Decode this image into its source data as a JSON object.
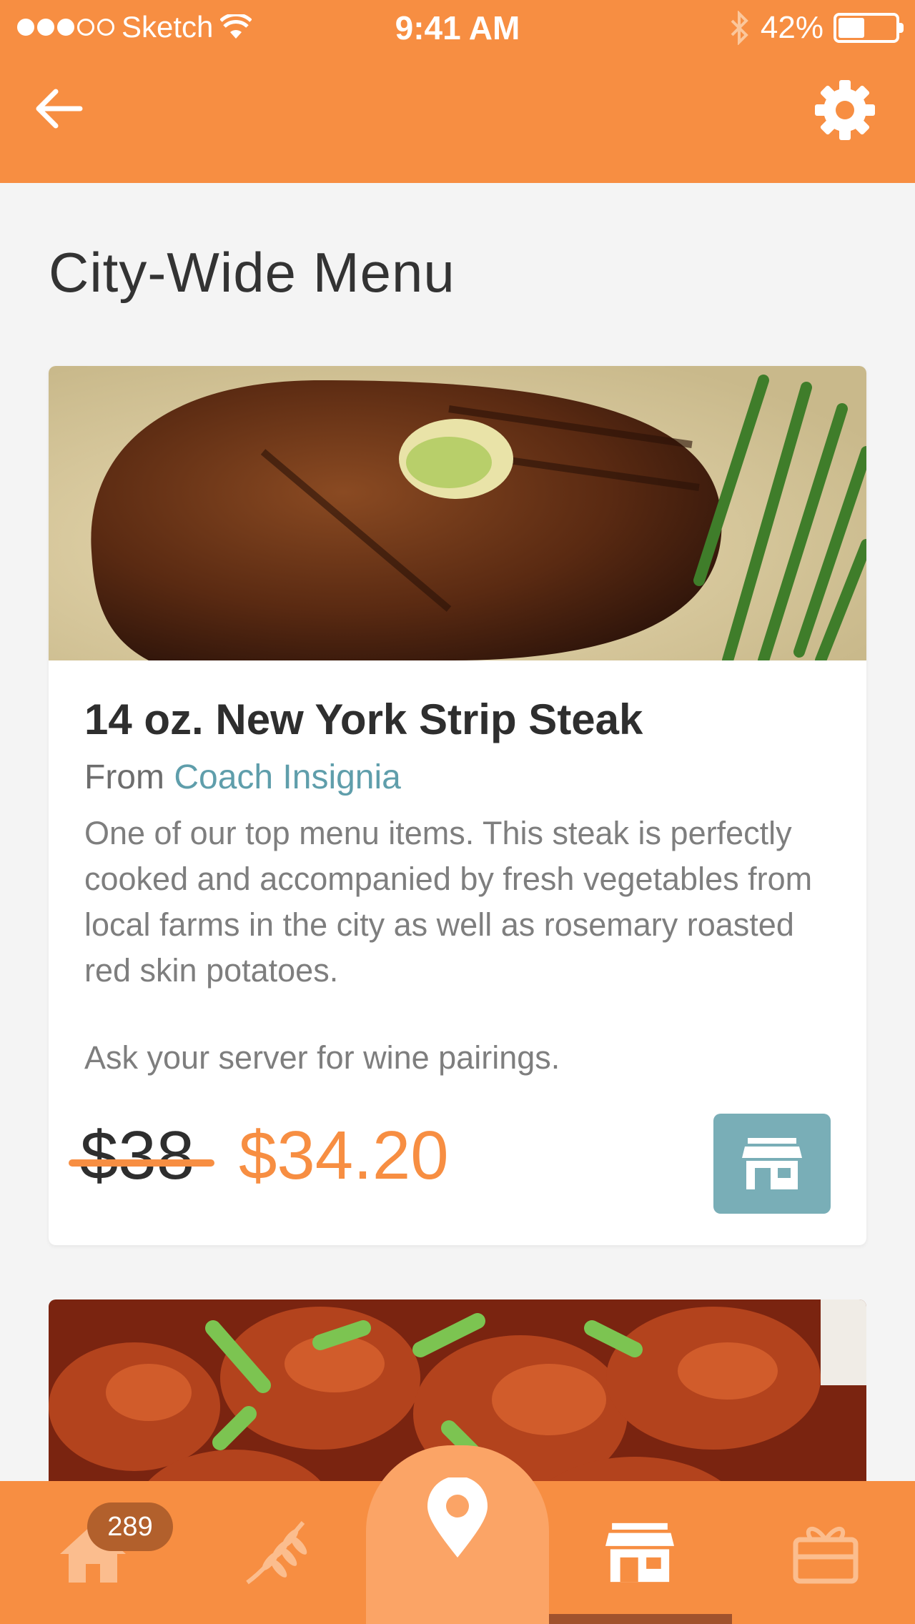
{
  "status_bar": {
    "carrier": "Sketch",
    "time": "9:41 AM",
    "battery": "42%",
    "signal_bars_filled": 3,
    "signal_bars_total": 5
  },
  "nav": {
    "back_icon": "arrow-left-icon",
    "settings_icon": "gear-icon"
  },
  "page": {
    "title": "City-Wide Menu"
  },
  "menu_items": [
    {
      "name": "14 oz. New York Strip Steak",
      "from_prefix": "From",
      "restaurant": "Coach Insignia",
      "description": "One of our top menu items. This steak is perfectly cooked and accompanied by fresh vegetables from local farms in the city as well as rosemary roasted red skin potatoes.",
      "note": "Ask your server for wine pairings.",
      "old_price": "$38",
      "new_price": "$34.20",
      "action_icon": "storefront-icon"
    }
  ],
  "tab_bar": {
    "tabs": [
      {
        "icon": "home-icon"
      },
      {
        "icon": "wheat-icon"
      },
      {
        "icon": "map-pin-icon"
      },
      {
        "icon": "storefront-icon"
      },
      {
        "icon": "gift-icon"
      }
    ],
    "home_badge": "289",
    "active_tab": "storefront-icon"
  },
  "colors": {
    "primary": "#f78e42",
    "accent_teal": "#79aeb7",
    "link": "#5f9eab",
    "badge": "#b2602c"
  }
}
